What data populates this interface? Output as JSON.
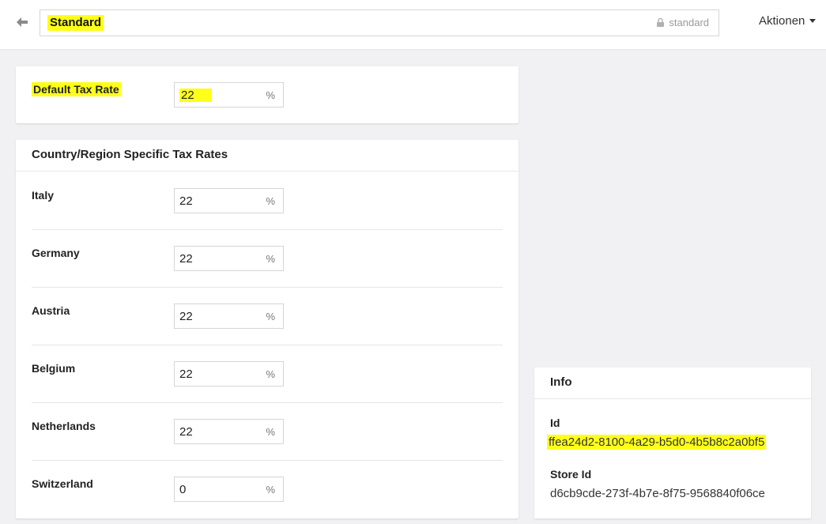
{
  "header": {
    "title": "Standard",
    "code": "standard",
    "actions_label": "Aktionen"
  },
  "default_tax": {
    "label": "Default Tax Rate",
    "value": "22",
    "unit": "%"
  },
  "country_rates": {
    "title": "Country/Region Specific Tax Rates",
    "unit": "%",
    "rows": [
      {
        "country": "Italy",
        "value": "22"
      },
      {
        "country": "Germany",
        "value": "22"
      },
      {
        "country": "Austria",
        "value": "22"
      },
      {
        "country": "Belgium",
        "value": "22"
      },
      {
        "country": "Netherlands",
        "value": "22"
      },
      {
        "country": "Switzerland",
        "value": "0"
      }
    ]
  },
  "info": {
    "title": "Info",
    "id_label": "Id",
    "id_value": "ffea24d2-8100-4a29-b5d0-4b5b8c2a0bf5",
    "store_id_label": "Store Id",
    "store_id_value": "d6cb9cde-273f-4b7e-8f75-9568840f06ce"
  },
  "colors": {
    "highlight": "#ffff1a",
    "background": "#f1f1f3"
  },
  "icons": {
    "back": "arrow-left-icon",
    "lock": "lock-icon",
    "caret": "caret-down-icon"
  }
}
